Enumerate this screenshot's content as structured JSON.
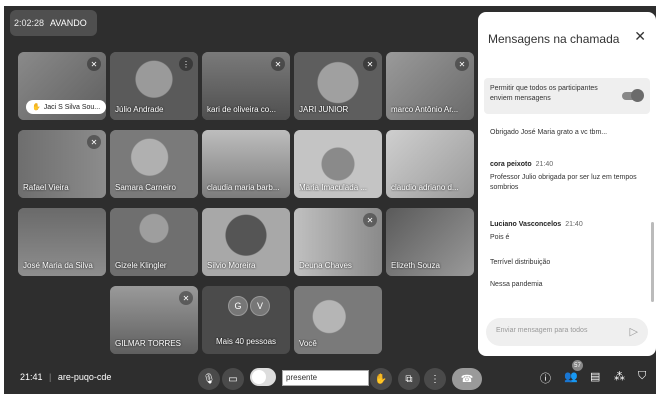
{
  "recording": {
    "time": "2:02:28",
    "label": "AVANDO"
  },
  "tiles": [
    {
      "name": "Jaci S Silva Sou...",
      "pill": true,
      "muted": true
    },
    {
      "name": "Júlio Andrade",
      "muted": false,
      "speaking": true
    },
    {
      "name": "kari de oliveira co...",
      "muted": true
    },
    {
      "name": "JARI JUNIOR",
      "muted": true
    },
    {
      "name": "marco Antônio Ar...",
      "muted": true
    },
    {
      "name": "Rafael Vieira",
      "muted": true
    },
    {
      "name": "Samara Carneiro",
      "muted": false
    },
    {
      "name": "claudia maria barb...",
      "muted": false
    },
    {
      "name": "Maria Imaculada ...",
      "muted": false
    },
    {
      "name": "claudio adriano d...",
      "muted": false
    },
    {
      "name": "José Maria da Silva",
      "muted": false
    },
    {
      "name": "Gizele Klingler",
      "muted": false
    },
    {
      "name": "Silvio Moreira",
      "muted": false
    },
    {
      "name": "Deuna Chaves",
      "muted": true
    },
    {
      "name": "Elizeth Souza",
      "muted": false
    },
    {
      "name": "GILMAR TORRES",
      "muted": true
    },
    {
      "name": "Mais 40 pessoas",
      "avatars": [
        "G",
        "V"
      ]
    },
    {
      "name": "Você",
      "muted": false
    }
  ],
  "chat": {
    "title": "Mensagens na chamada",
    "close": "✕",
    "permission_label": "Permitir que todos os participantes enviem mensagens",
    "messages": [
      {
        "text": "Obrigado José Maria grato a vc tbm..."
      },
      {
        "sender": "cora peixoto",
        "time": "21:40",
        "text": "Professor Julio obrigada por ser luz em tempos sombrios"
      },
      {
        "sender": "Luciano Vasconcelos",
        "time": "21:40",
        "text": "Pois é"
      },
      {
        "text": "Terrível distribuição"
      },
      {
        "text": "Nessa pandemia"
      }
    ],
    "input_placeholder": "Enviar mensagem para todos"
  },
  "bottom": {
    "clock": "21:41",
    "separator": "|",
    "meeting_code": "are-puqo-cde",
    "presente_text": "presente",
    "people_badge": "57"
  },
  "colors": {
    "frame_bg": "#2e2e2e",
    "panel_bg": "#ffffff",
    "tile_bg": "#6a6a6a"
  }
}
